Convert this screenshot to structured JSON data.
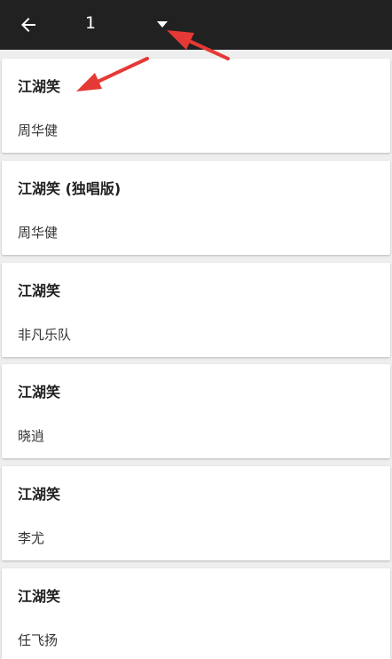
{
  "toolbar": {
    "back_icon": "arrow-left-icon",
    "selector_value": "1",
    "dropdown_icon": "triangle-down-icon"
  },
  "songs": [
    {
      "title": "江湖笑",
      "artist": "周华健"
    },
    {
      "title": "江湖笑 (独唱版)",
      "artist": "周华健"
    },
    {
      "title": "江湖笑",
      "artist": "非凡乐队"
    },
    {
      "title": "江湖笑",
      "artist": "晓逍"
    },
    {
      "title": "江湖笑",
      "artist": "李尤"
    },
    {
      "title": "江湖笑",
      "artist": "任飞扬"
    }
  ],
  "annotation_color": "#e53935",
  "toolbar_color": "#212121"
}
